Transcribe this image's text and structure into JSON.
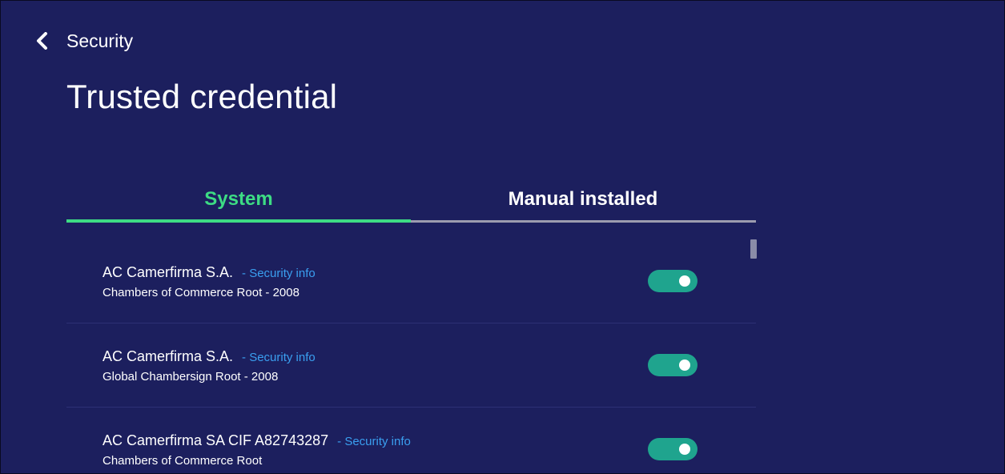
{
  "header": {
    "back_label": "Security",
    "title": "Trusted credential"
  },
  "tabs": [
    {
      "label": "System",
      "selected": true
    },
    {
      "label": "Manual installed",
      "selected": false
    }
  ],
  "colors": {
    "background": "#1c1f5e",
    "accent_tab": "#3ddc84",
    "link": "#3a9ff0",
    "toggle_on": "#1fa48e"
  },
  "icons": {
    "back": "chevron-left-icon"
  },
  "certificates": [
    {
      "issuer": "AC Camerfirma S.A.",
      "link": "- Security info",
      "name": "Chambers of Commerce Root - 2008",
      "enabled": true
    },
    {
      "issuer": "AC Camerfirma S.A.",
      "link": "- Security info",
      "name": "Global Chambersign Root - 2008",
      "enabled": true
    },
    {
      "issuer": "AC Camerfirma SA CIF A82743287",
      "link": "- Security info",
      "name": "Chambers of Commerce Root",
      "enabled": true
    }
  ]
}
